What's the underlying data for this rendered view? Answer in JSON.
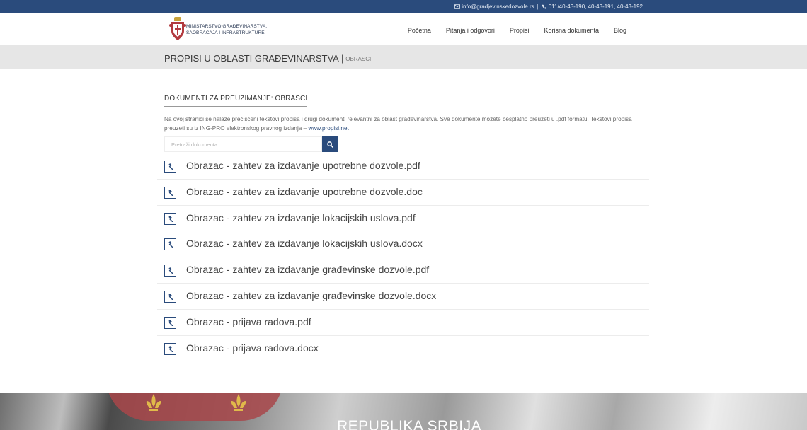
{
  "topbar": {
    "email": "info@gradjevinskedozvole.rs",
    "separator": "|",
    "phones": "011/40-43-190, 40-43-191, 40-43-192"
  },
  "header": {
    "ministry_line1": "MINISTARSTVO GRAĐEVINARSTVA,",
    "ministry_line2": "SAOBRAĆAJA I INFRASTRUKTURE",
    "nav": [
      "Početna",
      "Pitanja i odgovori",
      "Propisi",
      "Korisna dokumenta",
      "Blog"
    ]
  },
  "titlebar": {
    "title": "PROPISI U OBLASTI GRAĐEVINARSTVA",
    "separator": "|",
    "subtitle": "OBRASCI"
  },
  "content": {
    "heading": "DOKUMENTI ZA PREUZIMANJE: OBRASCI",
    "intro": "Na ovoj stranici se nalaze prečišćeni tekstovi propisa i drugi dokumenti relevantni za oblast građevinarstva. Sve dokumente možete besplatno preuzeti u .pdf formatu. Tekstovi propisa preuzeti su iz ING-PRO elektronskog pravnog izdanja –",
    "intro_link": "www.propisi.net",
    "search_placeholder": "Pretraži dokumenta..."
  },
  "documents": [
    "Obrazac - zahtev za izdavanje upotrebne dozvole.pdf",
    "Obrazac - zahtev za izdavanje upotrebne dozvole.doc",
    "Obrazac - zahtev za izdavanje lokacijskih uslova.pdf",
    "Obrazac - zahtev za izdavanje lokacijskih uslova.docx",
    "Obrazac - zahtev za izdavanje građevinske dozvole.pdf",
    "Obrazac - zahtev za izdavanje građevinske dozvole.docx",
    "Obrazac - prijava radova.pdf",
    "Obrazac - prijava radova.docx"
  ],
  "footer": {
    "country": "REPUBLIKA SRBIJA"
  },
  "icons": {
    "email": "envelope-icon",
    "phone": "phone-icon",
    "search": "search-icon",
    "document": "gavel-icon",
    "logo": "serbian-coat-of-arms"
  },
  "colors": {
    "primary": "#2a4b7c",
    "titlebar_bg": "#e6e6e6",
    "flag_red": "#a8464a"
  }
}
